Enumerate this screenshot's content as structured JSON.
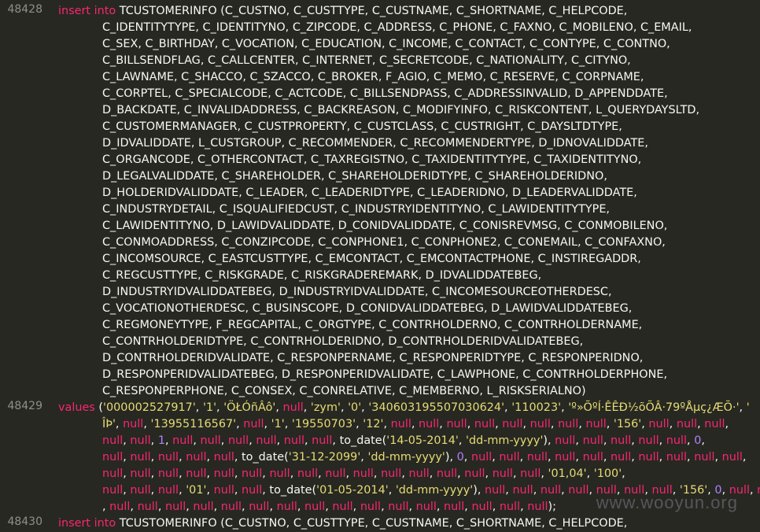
{
  "editor": {
    "line_numbers": [
      "48428",
      "48429",
      "48430"
    ],
    "statement1": {
      "keyword": "insert into",
      "lines": [
        "TCUSTOMERINFO (C_CUSTNO, C_CUSTTYPE, C_CUSTNAME, C_SHORTNAME, C_HELPCODE,",
        "C_IDENTITYTYPE, C_IDENTITYNO, C_ZIPCODE, C_ADDRESS, C_PHONE, C_FAXNO, C_MOBILENO, C_EMAIL,",
        "C_SEX, C_BIRTHDAY, C_VOCATION, C_EDUCATION, C_INCOME, C_CONTACT, C_CONTYPE, C_CONTNO,",
        "C_BILLSENDFLAG, C_CALLCENTER, C_INTERNET, C_SECRETCODE, C_NATIONALITY, C_CITYNO,",
        "C_LAWNAME, C_SHACCO, C_SZACCO, C_BROKER, F_AGIO, C_MEMO, C_RESERVE, C_CORPNAME,",
        "C_CORPTEL, C_SPECIALCODE, C_ACTCODE, C_BILLSENDPASS, C_ADDRESSINVALID, D_APPENDDATE,",
        "D_BACKDATE, C_INVALIDADDRESS, C_BACKREASON, C_MODIFYINFO, C_RISKCONTENT, L_QUERYDAYSLTD,",
        "C_CUSTOMERMANAGER, C_CUSTPROPERTY, C_CUSTCLASS, C_CUSTRIGHT, C_DAYSLTDTYPE,",
        "D_IDVALIDDATE, L_CUSTGROUP, C_RECOMMENDER, C_RECOMMENDERTYPE, D_IDNOVALIDDATE,",
        "C_ORGANCODE, C_OTHERCONTACT, C_TAXREGISTNO, C_TAXIDENTITYTYPE, C_TAXIDENTITYNO,",
        "D_LEGALVALIDDATE, C_SHAREHOLDER, C_SHAREHOLDERIDTYPE, C_SHAREHOLDERIDNO,",
        "D_HOLDERIDVALIDDATE, C_LEADER, C_LEADERIDTYPE, C_LEADERIDNO, D_LEADERVALIDDATE,",
        "C_INDUSTRYDETAIL, C_ISQUALIFIEDCUST, C_INDUSTRYIDENTITYNO, C_LAWIDENTITYTYPE,",
        "C_LAWIDENTITYNO, D_LAWIDVALIDDATE, D_CONIDVALIDDATE, C_CONISREVMSG, C_CONMOBILENO,",
        "C_CONMOADDRESS, C_CONZIPCODE, C_CONPHONE1, C_CONPHONE2, C_CONEMAIL, C_CONFAXNO,",
        "C_INCOMSOURCE, C_EASTCUSTTYPE, C_EMCONTACT, C_EMCONTACTPHONE, C_INSTIREGADDR,",
        "C_REGCUSTTYPE, C_RISKGRADE, C_RISKGRADEREMARK, D_IDVALIDDATEBEG,",
        "D_INDUSTRYIDVALIDDATEBEG, D_INDUSTRYIDVALIDDATE, C_INCOMESOURCEOTHERDESC,",
        "C_VOCATIONOTHERDESC, C_BUSINSCOPE, D_CONIDVALIDDATEBEG, D_LAWIDVALIDDATEBEG,",
        "C_REGMONEYTYPE, F_REGCAPITAL, C_ORGTYPE, C_CONTRHOLDERNO, C_CONTRHOLDERNAME,",
        "C_CONTRHOLDERIDTYPE, C_CONTRHOLDERIDNO, D_CONTRHOLDERIDVALIDATEBEG,",
        "D_CONTRHOLDERIDVALIDATE, C_RESPONPERNAME, C_RESPONPERIDTYPE, C_RESPONPERIDNO,",
        "D_RESPONPERIDVALIDATEBEG, D_RESPONPERIDVALIDATE, C_LAWPHONE, C_CONTRHOLDERPHONE,",
        "C_RESPONPERPHONE, C_CONSEX, C_CONRELATIVE, C_MEMBERNO, L_RISKSERIALNO)"
      ]
    },
    "statement2": {
      "keyword": "values",
      "lines": [
        [
          [
            "pn",
            "("
          ],
          [
            "str",
            "'000002527917'"
          ],
          [
            "pn",
            ", "
          ],
          [
            "str",
            "'1'"
          ],
          [
            "pn",
            ", "
          ],
          [
            "str",
            "'ÖŁÓñÂô'"
          ],
          [
            "pn",
            ", "
          ],
          [
            "null",
            "null"
          ],
          [
            "pn",
            ", "
          ],
          [
            "str",
            "'zym'"
          ],
          [
            "pn",
            ", "
          ],
          [
            "str",
            "'0'"
          ],
          [
            "pn",
            ", "
          ],
          [
            "str",
            "'340603195507030624'"
          ],
          [
            "pn",
            ", "
          ],
          [
            "str",
            "'110023'"
          ],
          [
            "pn",
            ", "
          ],
          [
            "str",
            "'º»ÕºÍ·ÊÊÐ½õÕÂ·79ºÅµç¿ÆÕ·'"
          ],
          [
            "pn",
            ", "
          ],
          [
            "str",
            "'"
          ]
        ],
        [
          [
            "str",
            "ÎÞ'"
          ],
          [
            "pn",
            ", "
          ],
          [
            "null",
            "null"
          ],
          [
            "pn",
            ", "
          ],
          [
            "str",
            "'13955116567'"
          ],
          [
            "pn",
            ", "
          ],
          [
            "null",
            "null"
          ],
          [
            "pn",
            ", "
          ],
          [
            "str",
            "'1'"
          ],
          [
            "pn",
            ", "
          ],
          [
            "str",
            "'19550703'"
          ],
          [
            "pn",
            ", "
          ],
          [
            "str",
            "'12'"
          ],
          [
            "pn",
            ", "
          ],
          [
            "null",
            "null"
          ],
          [
            "pn",
            ", "
          ],
          [
            "null",
            "null"
          ],
          [
            "pn",
            ", "
          ],
          [
            "null",
            "null"
          ],
          [
            "pn",
            ", "
          ],
          [
            "null",
            "null"
          ],
          [
            "pn",
            ", "
          ],
          [
            "null",
            "null"
          ],
          [
            "pn",
            ", "
          ],
          [
            "null",
            "null"
          ],
          [
            "pn",
            ", "
          ],
          [
            "null",
            "null"
          ],
          [
            "pn",
            ", "
          ],
          [
            "null",
            "null"
          ],
          [
            "pn",
            ", "
          ],
          [
            "str",
            "'156'"
          ],
          [
            "pn",
            ", "
          ],
          [
            "null",
            "null"
          ],
          [
            "pn",
            ", "
          ],
          [
            "null",
            "null"
          ],
          [
            "pn",
            ", "
          ],
          [
            "null",
            "null"
          ],
          [
            "pn",
            ","
          ]
        ],
        [
          [
            "null",
            "null"
          ],
          [
            "pn",
            ", "
          ],
          [
            "null",
            "null"
          ],
          [
            "pn",
            ", "
          ],
          [
            "num",
            "1"
          ],
          [
            "pn",
            ", "
          ],
          [
            "null",
            "null"
          ],
          [
            "pn",
            ", "
          ],
          [
            "null",
            "null"
          ],
          [
            "pn",
            ", "
          ],
          [
            "null",
            "null"
          ],
          [
            "pn",
            ", "
          ],
          [
            "null",
            "null"
          ],
          [
            "pn",
            ", "
          ],
          [
            "null",
            "null"
          ],
          [
            "pn",
            ", "
          ],
          [
            "null",
            "null"
          ],
          [
            "pn",
            ", "
          ],
          [
            "fn",
            "to_date("
          ],
          [
            "str",
            "'14-05-2014'"
          ],
          [
            "pn",
            ", "
          ],
          [
            "str",
            "'dd-mm-yyyy'"
          ],
          [
            "pn",
            "), "
          ],
          [
            "null",
            "null"
          ],
          [
            "pn",
            ", "
          ],
          [
            "null",
            "null"
          ],
          [
            "pn",
            ", "
          ],
          [
            "null",
            "null"
          ],
          [
            "pn",
            ", "
          ],
          [
            "null",
            "null"
          ],
          [
            "pn",
            ", "
          ],
          [
            "null",
            "null"
          ],
          [
            "pn",
            ", "
          ],
          [
            "num",
            "0"
          ],
          [
            "pn",
            ","
          ]
        ],
        [
          [
            "null",
            "null"
          ],
          [
            "pn",
            ", "
          ],
          [
            "null",
            "null"
          ],
          [
            "pn",
            ", "
          ],
          [
            "null",
            "null"
          ],
          [
            "pn",
            ", "
          ],
          [
            "null",
            "null"
          ],
          [
            "pn",
            ", "
          ],
          [
            "null",
            "null"
          ],
          [
            "pn",
            ", "
          ],
          [
            "fn",
            "to_date("
          ],
          [
            "str",
            "'31-12-2099'"
          ],
          [
            "pn",
            ", "
          ],
          [
            "str",
            "'dd-mm-yyyy'"
          ],
          [
            "pn",
            "), "
          ],
          [
            "num",
            "0"
          ],
          [
            "pn",
            ", "
          ],
          [
            "null",
            "null"
          ],
          [
            "pn",
            ", "
          ],
          [
            "null",
            "null"
          ],
          [
            "pn",
            ", "
          ],
          [
            "null",
            "null"
          ],
          [
            "pn",
            ", "
          ],
          [
            "null",
            "null"
          ],
          [
            "pn",
            ", "
          ],
          [
            "null",
            "null"
          ],
          [
            "pn",
            ", "
          ],
          [
            "null",
            "null"
          ],
          [
            "pn",
            ", "
          ],
          [
            "null",
            "null"
          ],
          [
            "pn",
            ", "
          ],
          [
            "null",
            "null"
          ],
          [
            "pn",
            ", "
          ],
          [
            "null",
            "null"
          ],
          [
            "pn",
            ", "
          ],
          [
            "null",
            "null"
          ],
          [
            "pn",
            ","
          ]
        ],
        [
          [
            "null",
            "null"
          ],
          [
            "pn",
            ", "
          ],
          [
            "null",
            "null"
          ],
          [
            "pn",
            ", "
          ],
          [
            "null",
            "null"
          ],
          [
            "pn",
            ", "
          ],
          [
            "null",
            "null"
          ],
          [
            "pn",
            ", "
          ],
          [
            "null",
            "null"
          ],
          [
            "pn",
            ", "
          ],
          [
            "null",
            "null"
          ],
          [
            "pn",
            ", "
          ],
          [
            "null",
            "null"
          ],
          [
            "pn",
            ", "
          ],
          [
            "null",
            "null"
          ],
          [
            "pn",
            ", "
          ],
          [
            "null",
            "null"
          ],
          [
            "pn",
            ", "
          ],
          [
            "null",
            "null"
          ],
          [
            "pn",
            ", "
          ],
          [
            "null",
            "null"
          ],
          [
            "pn",
            ", "
          ],
          [
            "null",
            "null"
          ],
          [
            "pn",
            ", "
          ],
          [
            "null",
            "null"
          ],
          [
            "pn",
            ", "
          ],
          [
            "null",
            "null"
          ],
          [
            "pn",
            ", "
          ],
          [
            "null",
            "null"
          ],
          [
            "pn",
            ", "
          ],
          [
            "null",
            "null"
          ],
          [
            "pn",
            ", "
          ],
          [
            "str",
            "'01,04'"
          ],
          [
            "pn",
            ", "
          ],
          [
            "str",
            "'100'"
          ],
          [
            "pn",
            ","
          ]
        ],
        [
          [
            "null",
            "null"
          ],
          [
            "pn",
            ", "
          ],
          [
            "null",
            "null"
          ],
          [
            "pn",
            ", "
          ],
          [
            "null",
            "null"
          ],
          [
            "pn",
            ", "
          ],
          [
            "str",
            "'01'"
          ],
          [
            "pn",
            ", "
          ],
          [
            "null",
            "null"
          ],
          [
            "pn",
            ", "
          ],
          [
            "null",
            "null"
          ],
          [
            "pn",
            ", "
          ],
          [
            "fn",
            "to_date("
          ],
          [
            "str",
            "'01-05-2014'"
          ],
          [
            "pn",
            ", "
          ],
          [
            "str",
            "'dd-mm-yyyy'"
          ],
          [
            "pn",
            "), "
          ],
          [
            "null",
            "null"
          ],
          [
            "pn",
            ", "
          ],
          [
            "null",
            "null"
          ],
          [
            "pn",
            ", "
          ],
          [
            "null",
            "null"
          ],
          [
            "pn",
            ", "
          ],
          [
            "null",
            "null"
          ],
          [
            "pn",
            ", "
          ],
          [
            "null",
            "null"
          ],
          [
            "pn",
            ", "
          ],
          [
            "null",
            "null"
          ],
          [
            "pn",
            ", "
          ],
          [
            "null",
            "null"
          ],
          [
            "pn",
            ", "
          ],
          [
            "str",
            "'156'"
          ],
          [
            "pn",
            ", "
          ],
          [
            "num",
            "0"
          ],
          [
            "pn",
            ", "
          ],
          [
            "null",
            "null"
          ],
          [
            "pn",
            ", "
          ],
          [
            "null",
            "null"
          ]
        ],
        [
          [
            "pn",
            ", "
          ],
          [
            "null",
            "null"
          ],
          [
            "pn",
            ", "
          ],
          [
            "null",
            "null"
          ],
          [
            "pn",
            ", "
          ],
          [
            "null",
            "null"
          ],
          [
            "pn",
            ", "
          ],
          [
            "null",
            "null"
          ],
          [
            "pn",
            ", "
          ],
          [
            "null",
            "null"
          ],
          [
            "pn",
            ", "
          ],
          [
            "null",
            "null"
          ],
          [
            "pn",
            ", "
          ],
          [
            "null",
            "null"
          ],
          [
            "pn",
            ", "
          ],
          [
            "null",
            "null"
          ],
          [
            "pn",
            ", "
          ],
          [
            "null",
            "null"
          ],
          [
            "pn",
            ", "
          ],
          [
            "null",
            "null"
          ],
          [
            "pn",
            ", "
          ],
          [
            "null",
            "null"
          ],
          [
            "pn",
            ", "
          ],
          [
            "null",
            "null"
          ],
          [
            "pn",
            ", "
          ],
          [
            "null",
            "null"
          ],
          [
            "pn",
            ", "
          ],
          [
            "null",
            "null"
          ],
          [
            "pn",
            ", "
          ],
          [
            "null",
            "null"
          ],
          [
            "pn",
            ", "
          ],
          [
            "null",
            "null"
          ],
          [
            "pn",
            ");"
          ]
        ]
      ]
    },
    "statement3": {
      "keyword": "insert into",
      "line": "TCUSTOMERINFO (C_CUSTNO, C_CUSTTYPE, C_CUSTNAME, C_SHORTNAME, C_HELPCODE,"
    }
  },
  "watermark": "www.wooyun.org"
}
